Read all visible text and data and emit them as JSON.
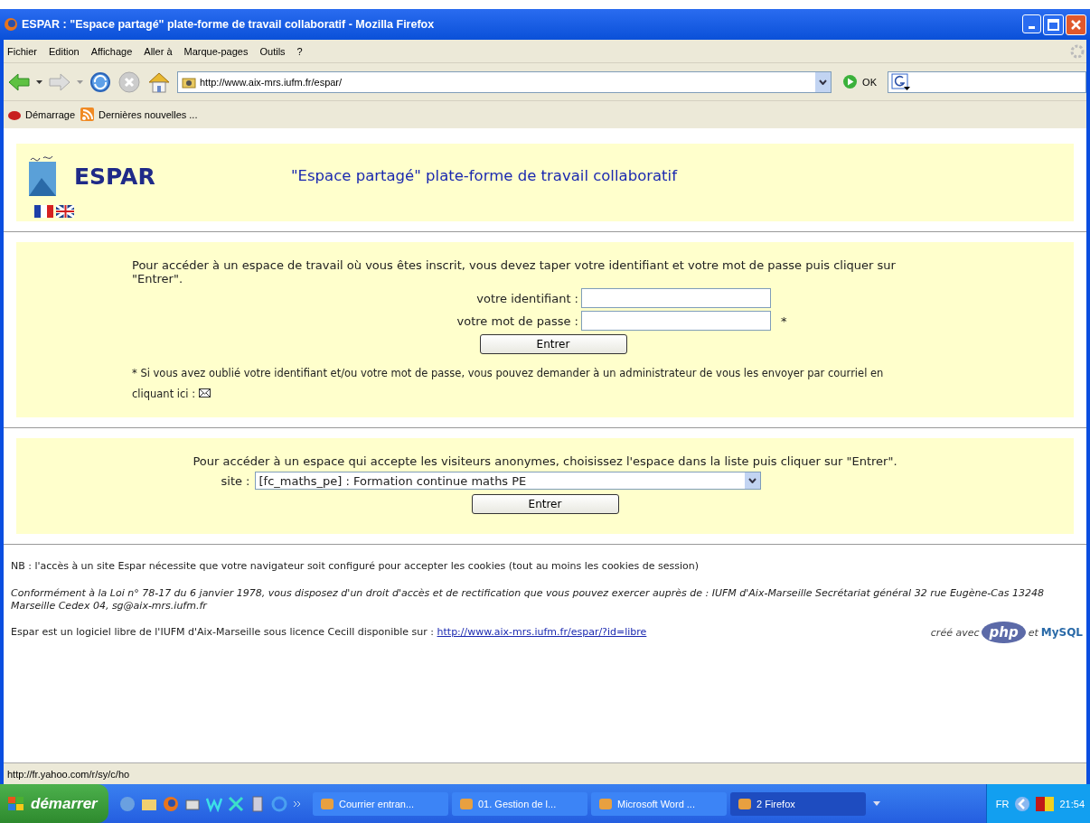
{
  "window": {
    "title": "ESPAR : \"Espace partagé\" plate-forme de travail collaboratif - Mozilla Firefox"
  },
  "menu": [
    "Fichier",
    "Edition",
    "Affichage",
    "Aller à",
    "Marque-pages",
    "Outils",
    "?"
  ],
  "toolbar": {
    "address": "http://www.aix-mrs.iufm.fr/espar/",
    "go_label": "OK"
  },
  "bookmarks": [
    "Démarrage",
    "Dernières nouvelles ..."
  ],
  "page": {
    "header": {
      "title": "ESPAR",
      "subtitle": "\"Espace partagé\" plate-forme de travail collaboratif"
    },
    "login": {
      "intro": "Pour accéder à un espace de travail où vous êtes inscrit, vous devez taper votre identifiant et votre mot de passe puis cliquer sur \"Entrer\".",
      "fields": [
        {
          "label": "votre identifiant :"
        },
        {
          "label": "votre mot de passe :",
          "mark": "*"
        }
      ],
      "button": "Entrer",
      "note": "* Si vous avez oublié votre identifiant et/ou votre mot de passe, vous pouvez demander à un administrateur de vous les envoyer par courriel en cliquant ici :"
    },
    "anonymous": {
      "intro": "Pour accéder à un espace qui accepte les visiteurs anonymes, choisissez l'espace dans la liste puis cliquer sur \"Entrer\".",
      "site_label": "site :",
      "site_value": "[fc_maths_pe] : Formation continue maths PE",
      "button": "Entrer"
    },
    "footer": {
      "nb": "NB : l'accès à un site Espar nécessite que votre navigateur soit configuré pour accepter les cookies (tout au moins les cookies de session)",
      "legal": "Conformément à la Loi n° 78-17 du 6 janvier 1978, vous disposez d'un droit d'accès et de rectification que vous pouvez exercer auprès de : IUFM d'Aix-Marseille Secrétariat général 32 rue Eugène-Cas 13248 Marseille Cedex 04, sg@aix-mrs.iufm.fr",
      "license": "Espar est un logiciel libre de l'IUFM d'Aix-Marseille sous licence Cecill disponible sur :",
      "license_link": "http://www.aix-mrs.iufm.fr/espar/?id=libre",
      "credit": "créé avec",
      "php": "php",
      "and": "et",
      "mysql": "MySQL"
    }
  },
  "status_bar": "http://fr.yahoo.com/r/sy/c/ho",
  "taskbar": {
    "start": "démarrer",
    "tasks": [
      {
        "label": "Courrier entran...",
        "selected": false
      },
      {
        "label": "01. Gestion de l...",
        "selected": false
      },
      {
        "label": "Microsoft Word ...",
        "selected": false
      },
      {
        "label": "2 Firefox",
        "selected": true
      }
    ],
    "lang": "FR",
    "clock": "21:54"
  }
}
